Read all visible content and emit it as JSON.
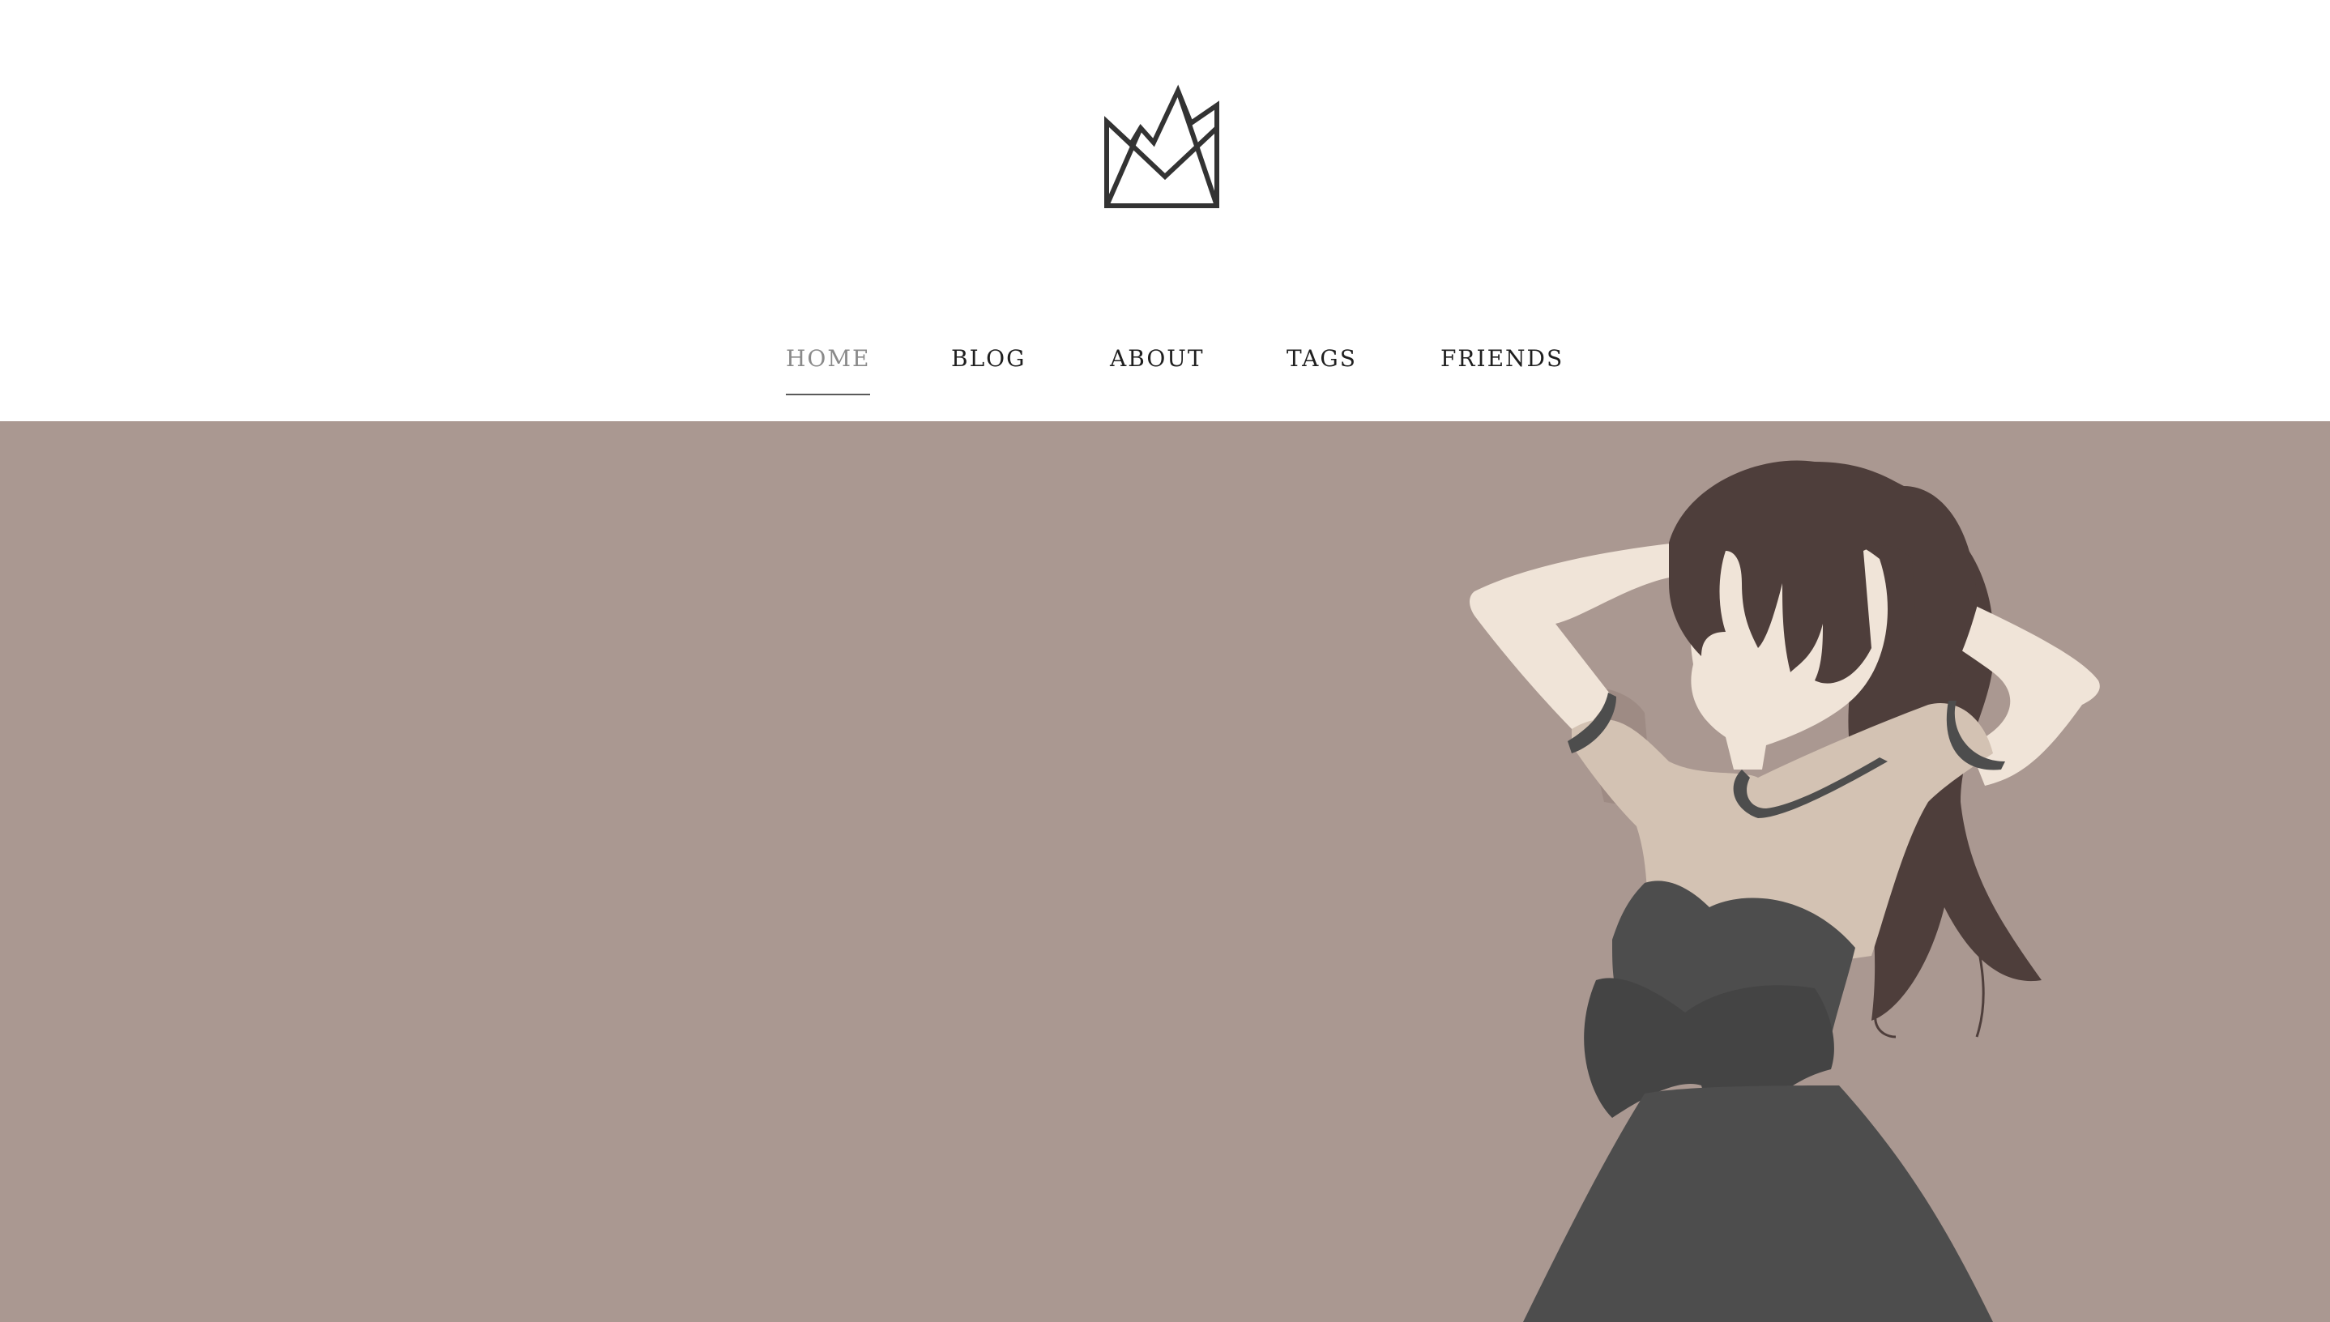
{
  "site": {
    "logo_icon": "crown-icon",
    "logo_color": "#333333"
  },
  "nav": {
    "items": [
      {
        "label": "HOME",
        "active": true
      },
      {
        "label": "BLOG",
        "active": false
      },
      {
        "label": "ABOUT",
        "active": false
      },
      {
        "label": "TAGS",
        "active": false
      },
      {
        "label": "FRIENDS",
        "active": false
      }
    ],
    "active_color": "#8a8a8a",
    "text_color": "#1f1f1f"
  },
  "hero": {
    "image_icon": "girl-silhouette-illustration",
    "background_color": "#aa9891",
    "hair_color": "#4e3e3b",
    "skin_color": "#f0e4d8",
    "top_color": "#d3c2b3",
    "dress_color": "#4d4d4d"
  }
}
